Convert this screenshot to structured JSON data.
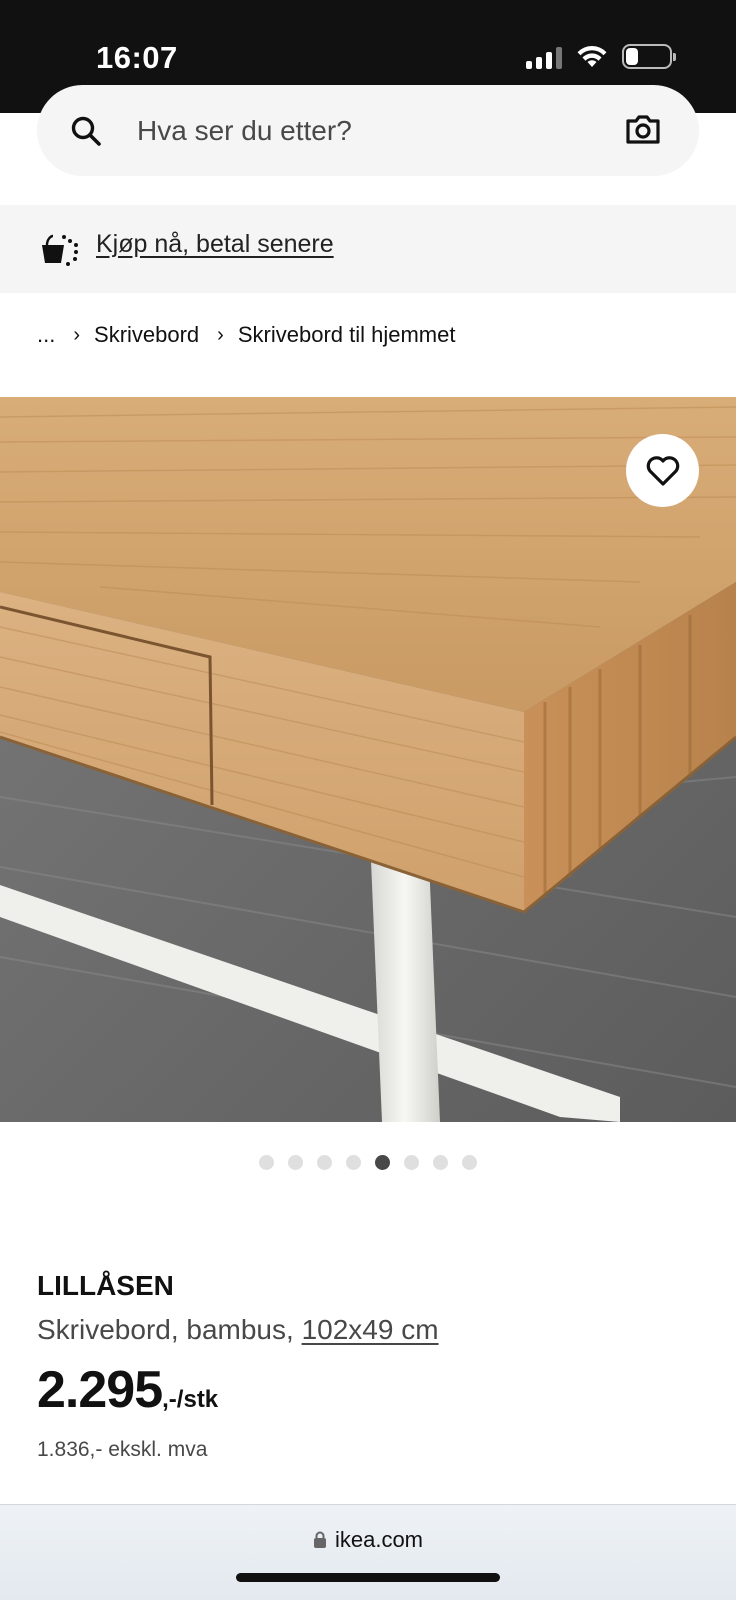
{
  "status_bar": {
    "time": "16:07"
  },
  "search": {
    "placeholder": "Hva ser du etter?"
  },
  "promo": {
    "link_text": "Kjøp nå, betal senere"
  },
  "breadcrumb": {
    "ellipsis": "...",
    "items": [
      "Skrivebord",
      "Skrivebord til hjemmet"
    ]
  },
  "product": {
    "name": "LILLÅSEN",
    "description": "Skrivebord, bambus,",
    "size": "102x49 cm",
    "price_integer": "2.295",
    "price_suffix": ",-/stk",
    "price_excl_vat": "1.836,- ekskl. mva"
  },
  "carousel": {
    "total": 8,
    "active_index": 4
  },
  "browser": {
    "url": "ikea.com"
  },
  "colors": {
    "accent": "#111111",
    "dot_active": "#484848",
    "dot_inactive": "#dfdfdf"
  }
}
